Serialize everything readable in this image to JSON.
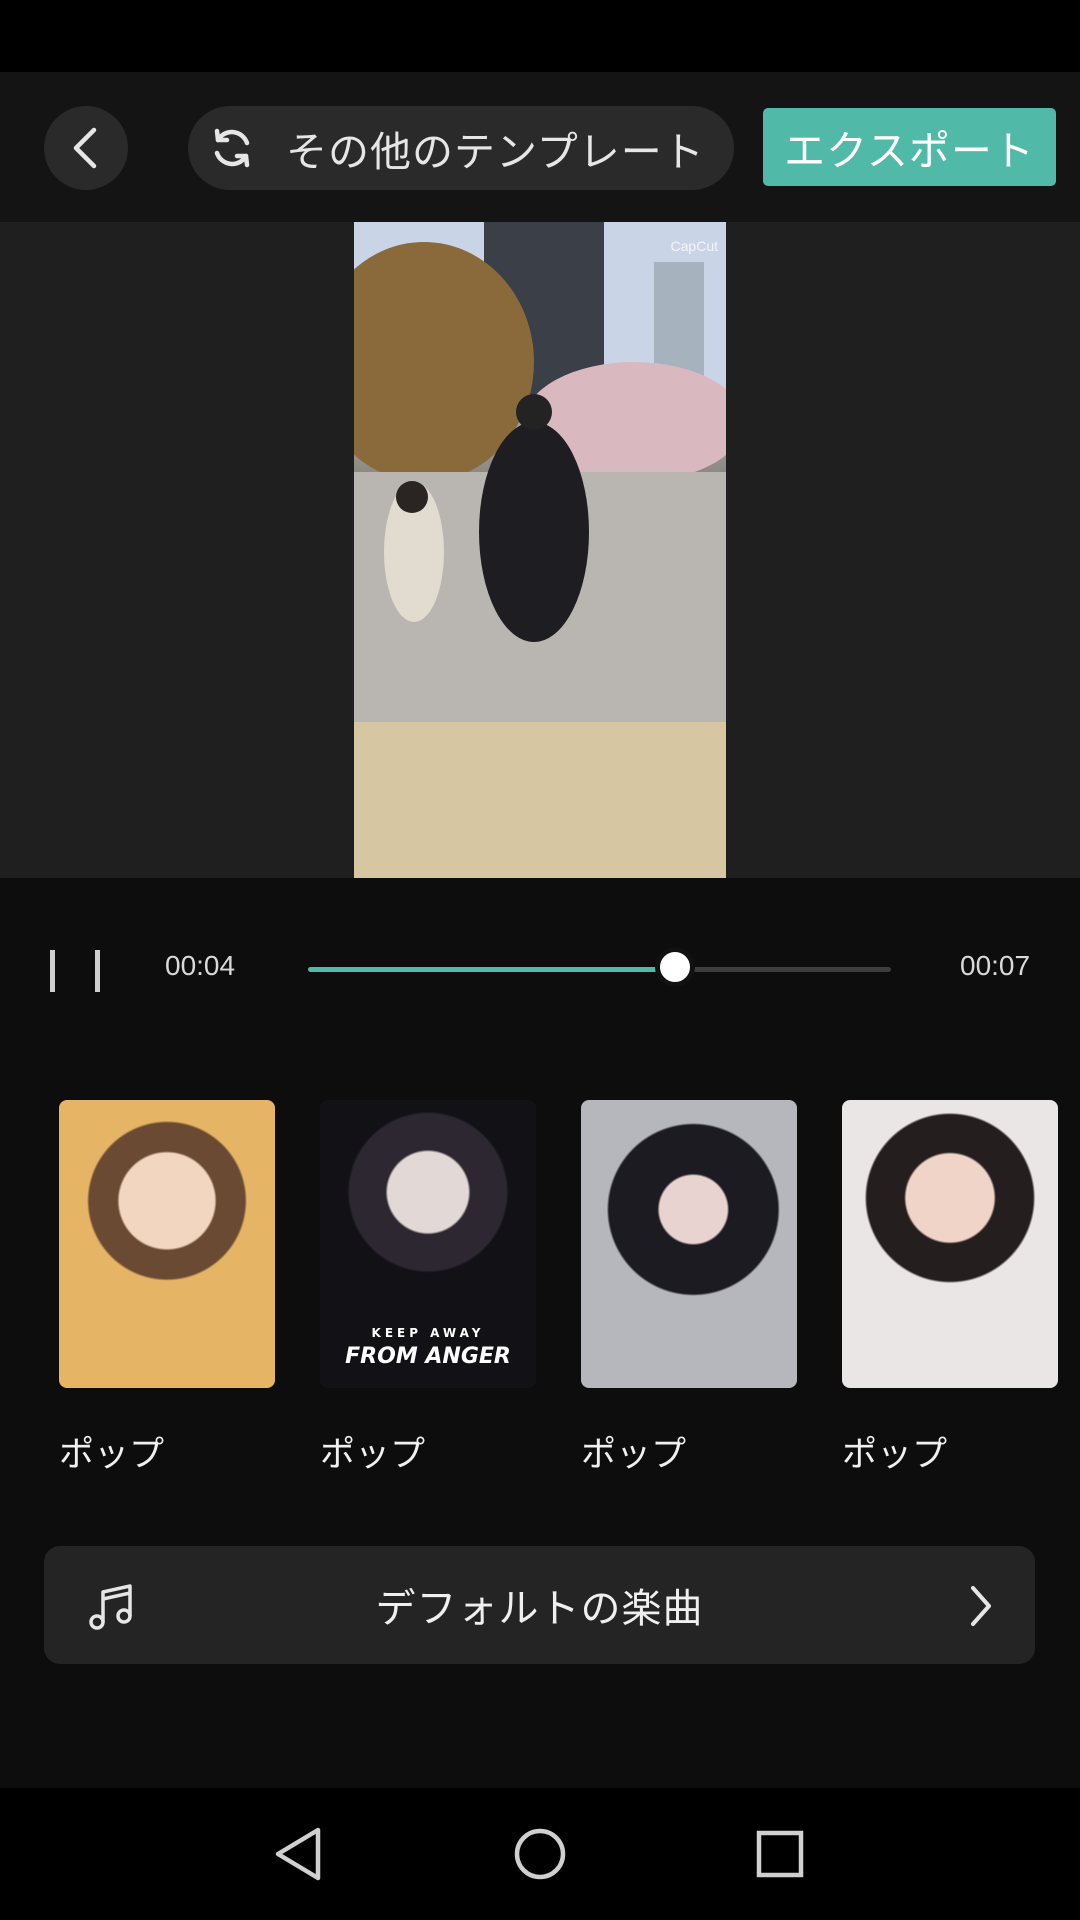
{
  "header": {
    "back_icon": "chevron-left-icon",
    "template_button": {
      "icon": "refresh-icon",
      "label": "その他のテンプレート"
    },
    "export_label": "エクスポート"
  },
  "preview": {
    "watermark": "CapCut"
  },
  "player": {
    "state_icon": "pause-icon",
    "current_time": "00:04",
    "total_time": "00:07",
    "progress": 0.63,
    "accent_color": "#51b9a8"
  },
  "styles": [
    {
      "label": "ポップ"
    },
    {
      "label": "ポップ",
      "overlay_small": "KEEP AWAY",
      "overlay_big": "FROM ANGER"
    },
    {
      "label": "ポップ"
    },
    {
      "label": "ポップ"
    }
  ],
  "music": {
    "icon": "music-note-icon",
    "label": "デフォルトの楽曲",
    "chevron_icon": "chevron-right-icon"
  },
  "navigation": {
    "back": "nav-back-icon",
    "home": "nav-home-icon",
    "recents": "nav-recents-icon"
  }
}
